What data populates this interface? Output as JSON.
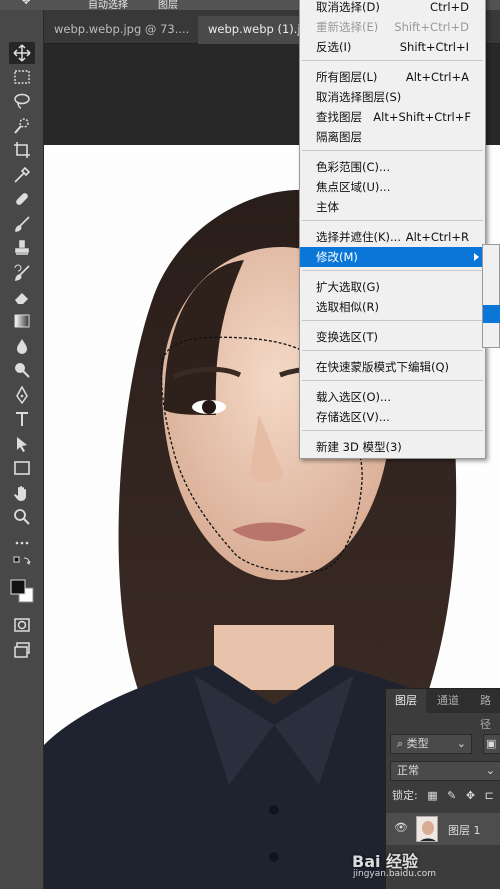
{
  "options_bar": {
    "auto_select_label": "自动选择",
    "layer_dropdown": "图层"
  },
  "tabs": [
    {
      "label": "webp.webp.jpg @ 73....",
      "close": "×"
    },
    {
      "label": "webp.webp (1).jp"
    }
  ],
  "menu": {
    "items": [
      {
        "label": "取消选择(D)",
        "shortcut": "Ctrl+D"
      },
      {
        "label": "重新选择(E)",
        "shortcut": "Shift+Ctrl+D"
      },
      {
        "label": "反选(I)",
        "shortcut": "Shift+Ctrl+I"
      },
      {
        "label": "所有图层(L)",
        "shortcut": "Alt+Ctrl+A"
      },
      {
        "label": "取消选择图层(S)",
        "shortcut": ""
      },
      {
        "label": "查找图层",
        "shortcut": "Alt+Shift+Ctrl+F"
      },
      {
        "label": "隔离图层",
        "shortcut": ""
      },
      {
        "label": "色彩范围(C)...",
        "shortcut": ""
      },
      {
        "label": "焦点区域(U)...",
        "shortcut": ""
      },
      {
        "label": "主体",
        "shortcut": ""
      },
      {
        "label": "选择并遮住(K)...",
        "shortcut": "Alt+Ctrl+R"
      },
      {
        "label": "修改(M)",
        "shortcut": ""
      },
      {
        "label": "扩大选取(G)",
        "shortcut": ""
      },
      {
        "label": "选取相似(R)",
        "shortcut": ""
      },
      {
        "label": "变换选区(T)",
        "shortcut": ""
      },
      {
        "label": "在快速蒙版模式下编辑(Q)",
        "shortcut": ""
      },
      {
        "label": "载入选区(O)...",
        "shortcut": ""
      },
      {
        "label": "存储选区(V)...",
        "shortcut": ""
      },
      {
        "label": "新建 3D 模型(3)",
        "shortcut": ""
      }
    ],
    "highlighted": "修改(M)",
    "disabled": "重新选择(E)"
  },
  "layers_panel": {
    "tabs": [
      "图层",
      "通道",
      "路径"
    ],
    "filter_label": "类型",
    "blend_mode": "正常",
    "lock_label": "锁定:",
    "layer_name": "图层 1"
  },
  "watermark": {
    "text": "Bai 经验",
    "sub": "jingyan.baidu.com"
  },
  "colors": {
    "menu_highlight": "#0a76d8",
    "panel_bg": "#3c3c3c",
    "toolbar_bg": "#484848"
  }
}
